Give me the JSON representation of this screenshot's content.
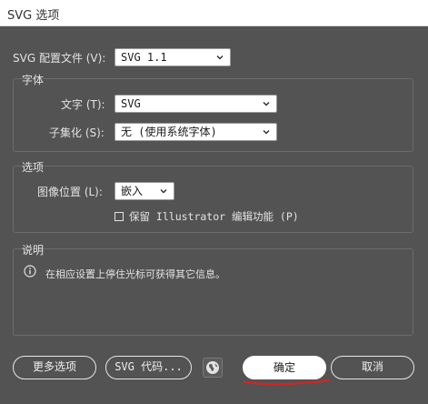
{
  "window": {
    "title": "SVG 选项"
  },
  "profile": {
    "label": "SVG 配置文件 (V):",
    "value": "SVG 1.1"
  },
  "font_group": {
    "title": "字体",
    "type_label": "文字 (T):",
    "type_value": "SVG",
    "subset_label": "子集化 (S):",
    "subset_value": "无 (使用系统字体)"
  },
  "options_group": {
    "title": "选项",
    "image_location_label": "图像位置 (L):",
    "image_location_value": "嵌入",
    "preserve_checkbox_label": "保留 Illustrator 编辑功能 (P)",
    "preserve_checked": false
  },
  "description_group": {
    "title": "说明",
    "text": "在相应设置上停住光标可获得其它信息。"
  },
  "buttons": {
    "more_options": "更多选项",
    "svg_code": "SVG 代码...",
    "ok": "确定",
    "cancel": "取消"
  },
  "icons": {
    "chevron": "chevron-down-icon",
    "info": "info-icon",
    "globe": "globe-icon"
  },
  "colors": {
    "background": "#535353",
    "annotation_red": "#e0201c"
  }
}
